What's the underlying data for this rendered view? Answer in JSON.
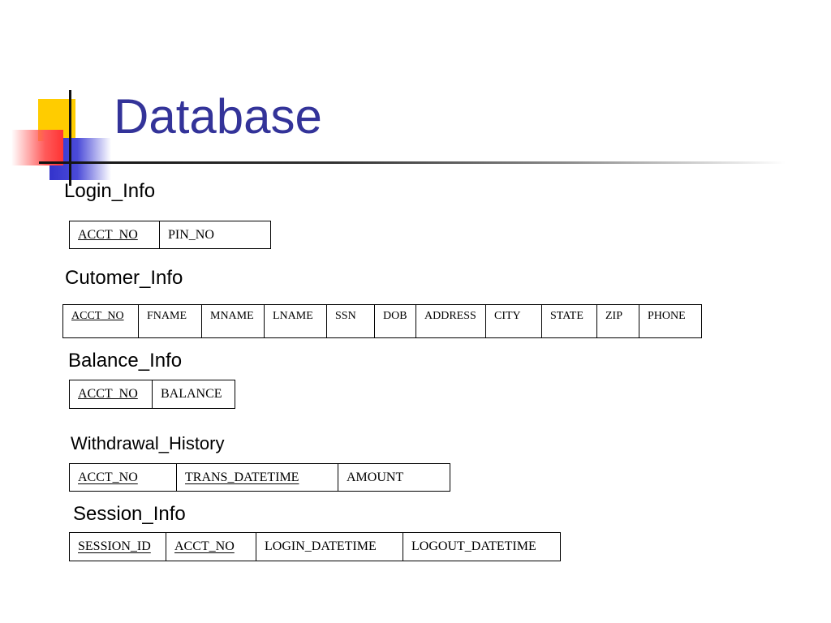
{
  "slide": {
    "title": "Database"
  },
  "sections": {
    "login_info": {
      "label": "Login_Info",
      "columns": [
        {
          "name": "ACCT_NO",
          "underline": true
        },
        {
          "name": "PIN_NO",
          "underline": false
        }
      ]
    },
    "customer_info": {
      "label": "Cutomer_Info",
      "columns": [
        {
          "name": "ACCT_NO",
          "underline": true
        },
        {
          "name": "FNAME",
          "underline": false
        },
        {
          "name": "MNAME",
          "underline": false
        },
        {
          "name": "LNAME",
          "underline": false
        },
        {
          "name": "SSN",
          "underline": false
        },
        {
          "name": "DOB",
          "underline": false
        },
        {
          "name": "ADDRESS",
          "underline": false
        },
        {
          "name": "CITY",
          "underline": false
        },
        {
          "name": "STATE",
          "underline": false
        },
        {
          "name": "ZIP",
          "underline": false
        },
        {
          "name": "PHONE",
          "underline": false
        }
      ]
    },
    "balance_info": {
      "label": "Balance_Info",
      "columns": [
        {
          "name": "ACCT_NO",
          "underline": true
        },
        {
          "name": "BALANCE",
          "underline": false
        }
      ]
    },
    "withdrawal_history": {
      "label": "Withdrawal_History",
      "columns": [
        {
          "name": "ACCT_NO",
          "underline": true
        },
        {
          "name": "TRANS_DATETIME",
          "underline": true
        },
        {
          "name": "AMOUNT",
          "underline": false
        }
      ]
    },
    "session_info": {
      "label": "Session_Info",
      "columns": [
        {
          "name": "SESSION_ID",
          "underline": true
        },
        {
          "name": "ACCT_NO",
          "underline": true
        },
        {
          "name": "LOGIN_DATETIME",
          "underline": false
        },
        {
          "name": "LOGOUT_DATETIME",
          "underline": false
        }
      ]
    }
  },
  "colors": {
    "title": "#333399",
    "accent_yellow": "#ffcc00",
    "accent_blue": "#3333cc",
    "accent_red": "#ff3333"
  }
}
